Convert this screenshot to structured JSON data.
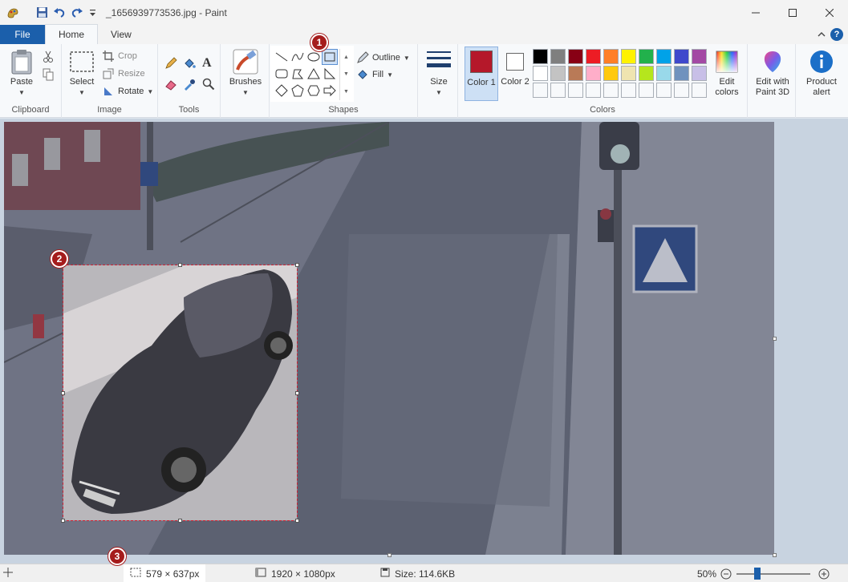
{
  "title": "_1656939773536.jpg - Paint",
  "tabs": {
    "file": "File",
    "home": "Home",
    "view": "View"
  },
  "clipboard": {
    "paste": "Paste",
    "label": "Clipboard"
  },
  "image": {
    "select": "Select",
    "crop": "Crop",
    "resize": "Resize",
    "rotate": "Rotate",
    "label": "Image"
  },
  "tools": {
    "label": "Tools"
  },
  "brushes": {
    "label": "Brushes"
  },
  "shapes": {
    "outline": "Outline",
    "fill": "Fill",
    "label": "Shapes"
  },
  "size": {
    "label": "Size"
  },
  "colors": {
    "color1": "Color 1",
    "color2": "Color 2",
    "edit": "Edit colors",
    "label": "Colors",
    "color1_value": "#b5182a",
    "color2_value": "#ffffff",
    "palette_row1": [
      "#000000",
      "#7f7f7f",
      "#880015",
      "#ed1c24",
      "#ff7f27",
      "#fff200",
      "#22b14c",
      "#00a2e8",
      "#3f48cc",
      "#a349a4"
    ],
    "palette_row2": [
      "#ffffff",
      "#c3c3c3",
      "#b97a57",
      "#ffaec9",
      "#ffc90e",
      "#efe4b0",
      "#b5e61d",
      "#99d9ea",
      "#7092be",
      "#c8bfe7"
    ]
  },
  "paint3d": {
    "label": "Edit with Paint 3D"
  },
  "product_alert": {
    "label": "Product alert"
  },
  "status": {
    "selection_size": "579 × 637px",
    "image_size": "1920 × 1080px",
    "file_size": "Size: 114.6KB",
    "zoom": "50%"
  },
  "badges": {
    "one": "1",
    "two": "2",
    "three": "3"
  }
}
